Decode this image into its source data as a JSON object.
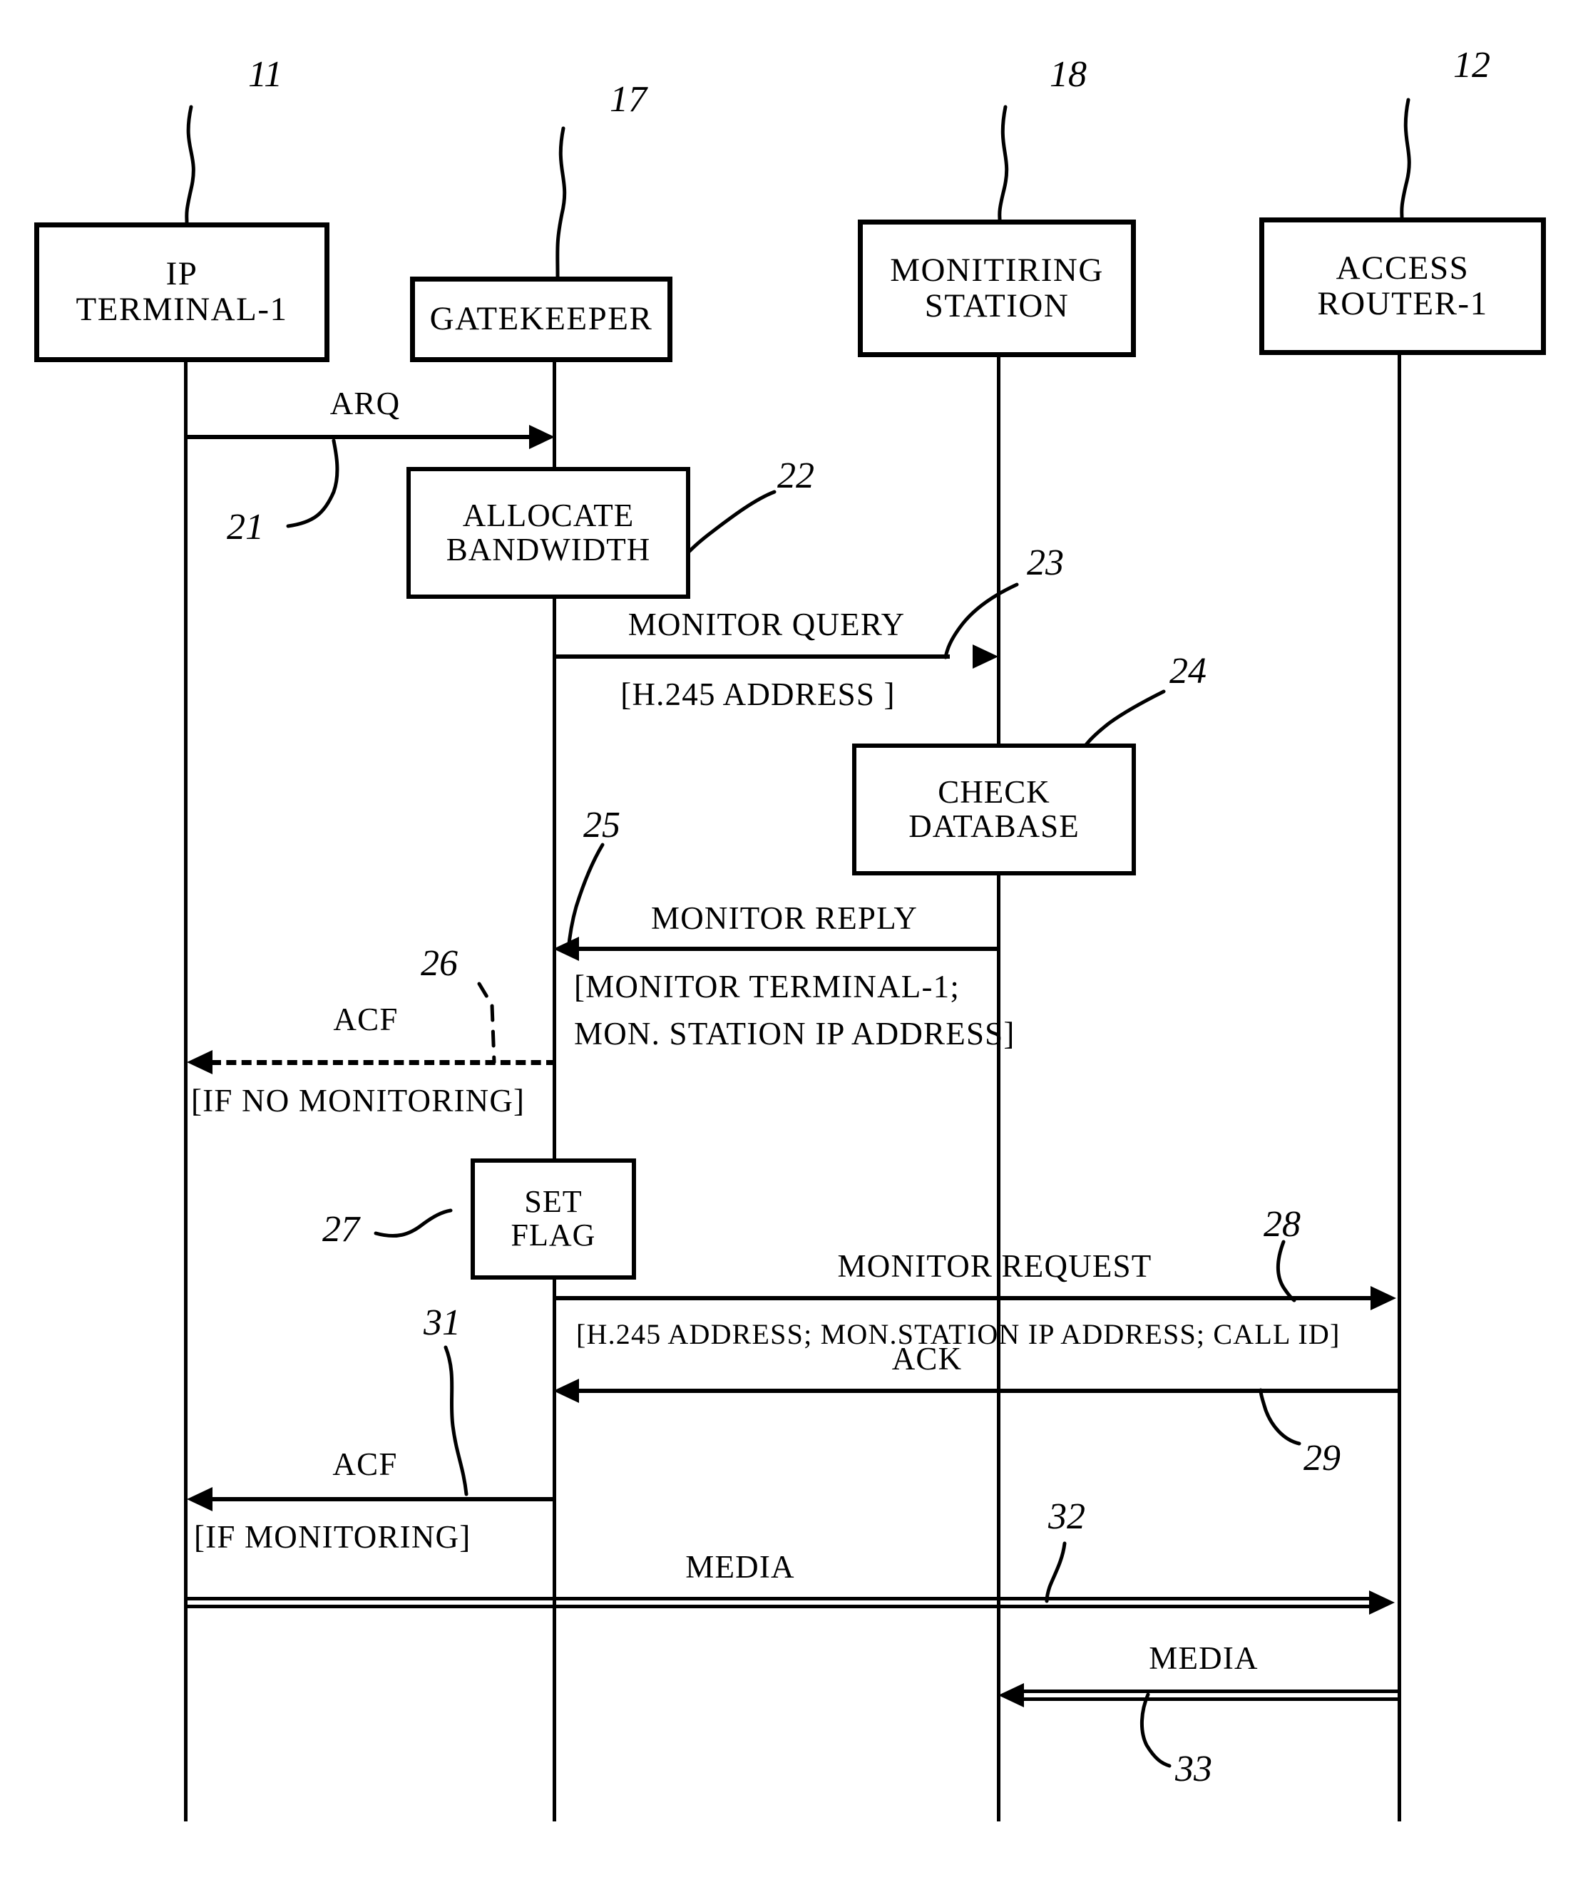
{
  "figure": {
    "type": "patent-sequence-diagram",
    "title": "IP telephony monitoring call-flow"
  },
  "entities": [
    {
      "id": "ip-terminal-1",
      "lines": [
        "IP",
        "TERMINAL-1"
      ],
      "ref": "11"
    },
    {
      "id": "gatekeeper",
      "lines": [
        "GATEKEEPER"
      ],
      "ref": "17"
    },
    {
      "id": "monitoring-station",
      "lines": [
        "MONITIRING",
        "STATION"
      ],
      "ref": "18"
    },
    {
      "id": "access-router-1",
      "lines": [
        "ACCESS",
        "ROUTER-1"
      ],
      "ref": "12"
    }
  ],
  "processes": [
    {
      "id": "allocate-bandwidth",
      "lines": [
        "ALLOCATE",
        "BANDWIDTH"
      ],
      "ref": "22"
    },
    {
      "id": "check-database",
      "lines": [
        "CHECK",
        "DATABASE"
      ],
      "ref": "24"
    },
    {
      "id": "set-flag",
      "lines": [
        "SET",
        "FLAG"
      ],
      "ref": "27"
    }
  ],
  "messages": [
    {
      "id": "arq",
      "label": "ARQ",
      "params": null,
      "from": "ip-terminal-1",
      "to": "gatekeeper",
      "ref": "21",
      "style": "solid"
    },
    {
      "id": "monitor-query",
      "label": "MONITOR QUERY",
      "params": "[H.245  ADDRESS ]",
      "from": "gatekeeper",
      "to": "monitoring-station",
      "ref": "23",
      "style": "solid"
    },
    {
      "id": "monitor-reply",
      "label": "MONITOR REPLY",
      "params_line1": "[MONITOR TERMINAL-1;",
      "params_line2": "MON. STATION IP ADDRESS]",
      "from": "monitoring-station",
      "to": "gatekeeper",
      "ref": "25",
      "style": "solid"
    },
    {
      "id": "acf-no-monitoring",
      "label": "ACF",
      "params": "[IF NO MONITORING]",
      "from": "gatekeeper",
      "to": "ip-terminal-1",
      "ref": "26",
      "style": "dashed"
    },
    {
      "id": "monitor-request",
      "label": "MONITOR REQUEST",
      "params": "[H.245 ADDRESS; MON.STATION IP ADDRESS; CALL ID]",
      "from": "gatekeeper",
      "to": "access-router-1",
      "ref": "28",
      "style": "solid"
    },
    {
      "id": "ack",
      "label": "ACK",
      "params": null,
      "from": "access-router-1",
      "to": "gatekeeper",
      "ref": "29",
      "style": "solid"
    },
    {
      "id": "acf-monitoring",
      "label": "ACF",
      "params": "[IF MONITORING]",
      "from": "gatekeeper",
      "to": "ip-terminal-1",
      "ref": "31",
      "style": "solid"
    },
    {
      "id": "media-forward",
      "label": "MEDIA",
      "params": null,
      "from": "ip-terminal-1",
      "to": "access-router-1",
      "ref": "32",
      "style": "double"
    },
    {
      "id": "media-reverse",
      "label": "MEDIA",
      "params": null,
      "from": "access-router-1",
      "to": "monitoring-station",
      "ref": "33",
      "style": "double"
    }
  ]
}
